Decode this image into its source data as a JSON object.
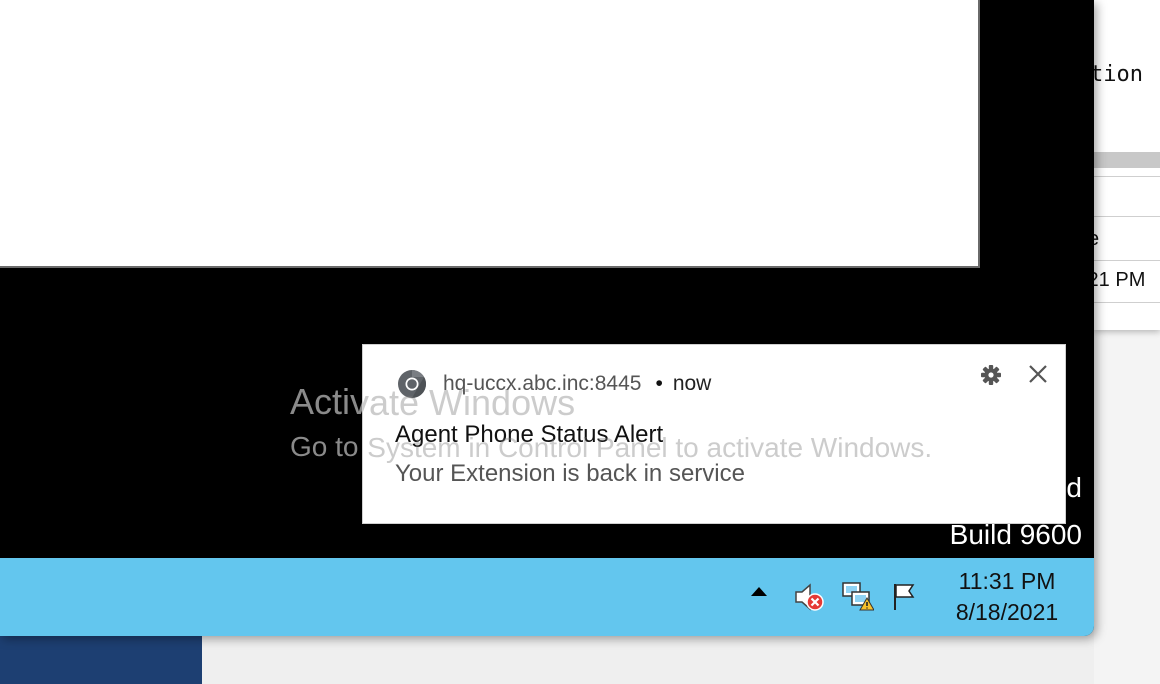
{
  "background": {
    "right_panel": {
      "text_top": "tion",
      "text_mid": "e",
      "text_bottom": ":21 PM"
    }
  },
  "watermark": {
    "title": "Activate Windows",
    "subtitle": "Go to System in Control Panel to activate Windows.",
    "edition_fragment": "d",
    "build": "Build 9600"
  },
  "notification": {
    "source": "hq-uccx.abc.inc:8445",
    "separator": "•",
    "time": "now",
    "title": "Agent Phone Status Alert",
    "body": "Your Extension is back in service"
  },
  "taskbar": {
    "clock": {
      "time": "11:31 PM",
      "date": "8/18/2021"
    },
    "tray_icons": [
      "show-hidden-icons-arrow",
      "volume-muted-icon",
      "network-warning-icon",
      "action-center-flag-icon"
    ]
  },
  "colors": {
    "taskbar": "#63c6ee",
    "desktop": "#000000",
    "toast_bg": "#ffffff"
  }
}
